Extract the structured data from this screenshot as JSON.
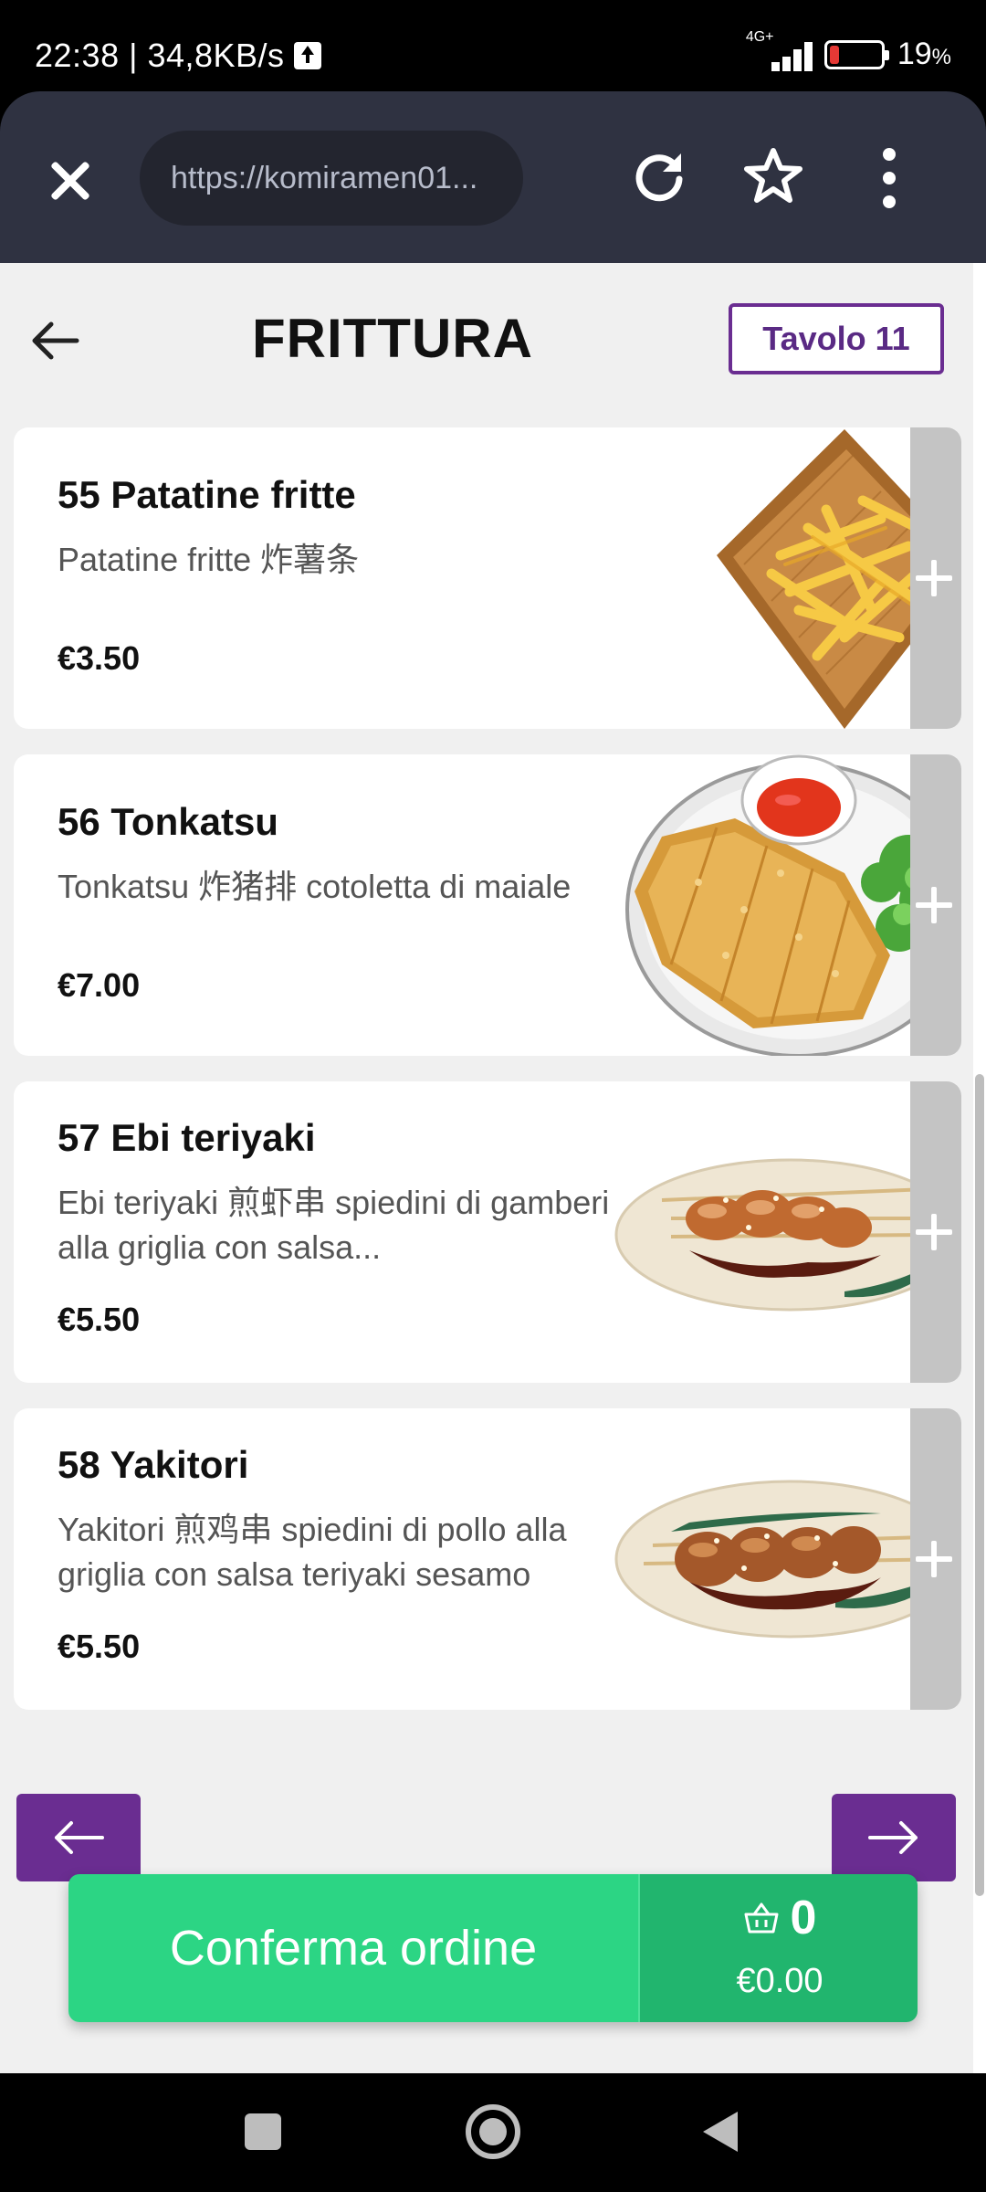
{
  "status_bar": {
    "time": "22:38 | 34,8KB/s",
    "network": "4G+",
    "battery_percent": "19",
    "battery_suffix": "%",
    "battery_level": 0.19
  },
  "browser": {
    "url": "https://komiramen01...",
    "icons": [
      "close-icon",
      "reload-icon",
      "star-icon",
      "more-vert-icon"
    ]
  },
  "header": {
    "title": "FRITTURA",
    "table_label": "Tavolo 11"
  },
  "items": [
    {
      "title": "55 Patatine fritte",
      "description": "Patatine fritte 炸薯条",
      "price": "€3.50",
      "image": "fries-in-basket"
    },
    {
      "title": "56 Tonkatsu",
      "description": "Tonkatsu 炸猪排 cotoletta di maiale",
      "price": "€7.00",
      "image": "tonkatsu-plate"
    },
    {
      "title": "57 Ebi teriyaki",
      "description": "Ebi teriyaki 煎虾串 spiedini di gamberi alla griglia con salsa...",
      "price": "€5.50",
      "image": "shrimp-skewers"
    },
    {
      "title": "58 Yakitori",
      "description": "Yakitori 煎鸡串 spiedini di pollo alla griglia con salsa teriyaki sesamo",
      "price": "€5.50",
      "image": "chicken-skewers"
    }
  ],
  "order": {
    "confirm_label": "Conferma ordine",
    "cart_count": "0",
    "cart_total": "€0.00"
  },
  "colors": {
    "accent_purple": "#6a2d91",
    "confirm_green": "#2cd584",
    "cart_green": "#21b56e",
    "browser_bar": "#2f3241"
  }
}
